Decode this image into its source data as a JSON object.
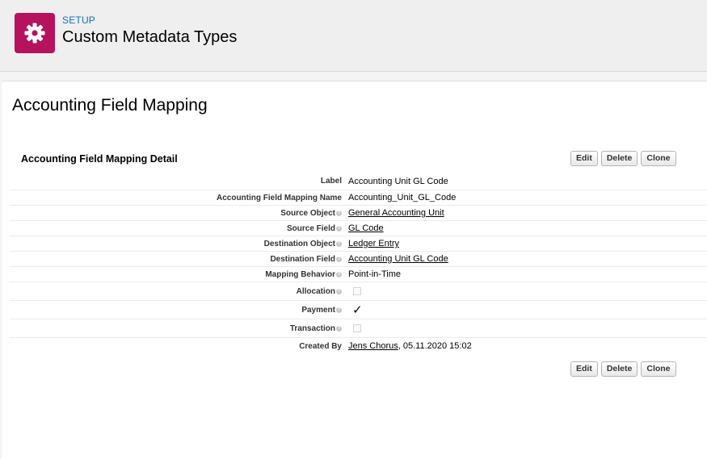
{
  "header": {
    "setup_label": "SETUP",
    "title": "Custom Metadata Types",
    "icon": "gear-icon",
    "icon_color": "#b5135e"
  },
  "page": {
    "title": "Accounting Field Mapping"
  },
  "detail": {
    "title": "Accounting Field Mapping Detail",
    "buttons": {
      "edit": "Edit",
      "delete": "Delete",
      "clone": "Clone"
    },
    "fields": {
      "label": {
        "label": "Label",
        "value": "Accounting Unit GL Code"
      },
      "name": {
        "label": "Accounting Field Mapping Name",
        "value": "Accounting_Unit_GL_Code"
      },
      "source_object": {
        "label": "Source Object",
        "value": "General Accounting Unit"
      },
      "source_field": {
        "label": "Source Field",
        "value": "GL Code"
      },
      "destination_object": {
        "label": "Destination Object",
        "value": "Ledger Entry"
      },
      "destination_field": {
        "label": "Destination Field",
        "value": "Accounting Unit GL Code"
      },
      "mapping_behavior": {
        "label": "Mapping Behavior",
        "value": "Point-in-Time"
      },
      "allocation": {
        "label": "Allocation",
        "checked": false
      },
      "payment": {
        "label": "Payment",
        "checked": true
      },
      "transaction": {
        "label": "Transaction",
        "checked": false
      },
      "created_by": {
        "label": "Created By",
        "user": "Jens Chorus",
        "date": ", 05.11.2020 15:02"
      }
    }
  }
}
